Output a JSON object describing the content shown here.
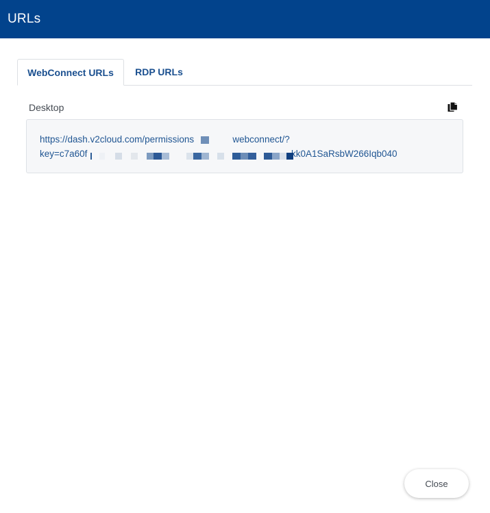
{
  "dialog": {
    "title": "URLs"
  },
  "tabs": [
    {
      "label": "WebConnect URLs",
      "active": true
    },
    {
      "label": "RDP URLs",
      "active": false
    }
  ],
  "section": {
    "label": "Desktop",
    "copy_icon": "copy-icon"
  },
  "url": {
    "line1_start": "https://dash.v2cloud.com/permissions",
    "line1_end": "webconnect/?",
    "line2_start": "key=c7a60f",
    "line2_end": "kk0A1SaRsbW266Iqb040"
  },
  "footer": {
    "close_label": "Close"
  },
  "colors": {
    "header_bg": "#02438c",
    "tab_text": "#1a4f8f",
    "link_text": "#1f5592"
  }
}
